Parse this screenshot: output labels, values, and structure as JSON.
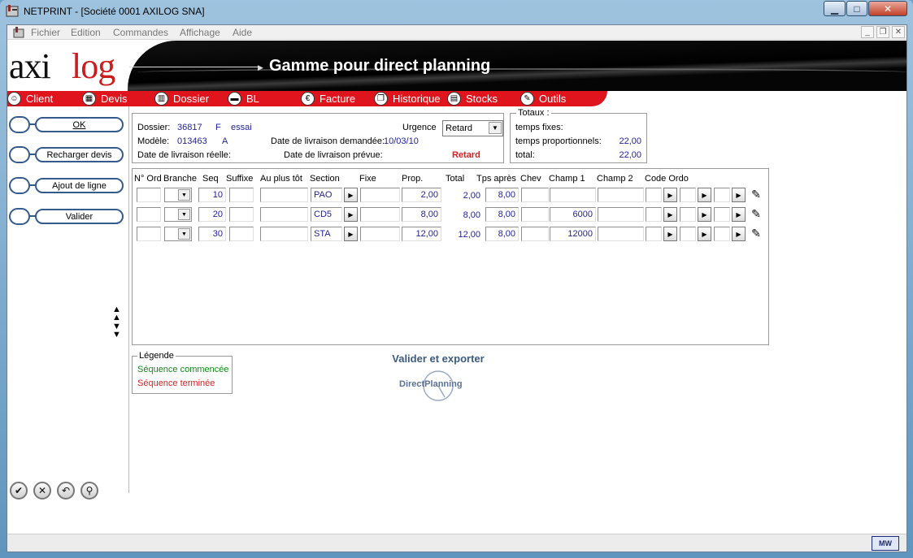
{
  "window": {
    "title": "NETPRINT - [Société 0001 AXILOG SNA]"
  },
  "menu": [
    "Fichier",
    "Edition",
    "Commandes",
    "Affichage",
    "Aide"
  ],
  "banner": {
    "logo_black": "axi",
    "logo_red": "log",
    "title": "Gamme pour direct planning"
  },
  "nav": [
    {
      "label": "Client",
      "icon": "client-icon"
    },
    {
      "label": "Devis",
      "icon": "calculator-icon"
    },
    {
      "label": "Dossier",
      "icon": "chart-icon"
    },
    {
      "label": "BL",
      "icon": "truck-icon"
    },
    {
      "label": "Facture",
      "icon": "euro-icon"
    },
    {
      "label": "Historique",
      "icon": "copy-icon"
    },
    {
      "label": "Stocks",
      "icon": "stocks-icon"
    },
    {
      "label": "Outils",
      "icon": "wrench-icon"
    }
  ],
  "left_buttons": [
    "OK",
    "Recharger devis",
    "Ajout de ligne",
    "Valider"
  ],
  "header": {
    "dossier_label": "Dossier:",
    "dossier_num": "36817",
    "dossier_code": "F",
    "dossier_name": "essai",
    "modele_label": "Modèle:",
    "modele_num": "013463",
    "modele_code": "A",
    "livraison_reelle_label": "Date de livraison réelle:",
    "livraison_demandee_label": "Date de livraison demandée:",
    "livraison_demandee_value": "10/03/10",
    "livraison_prevue_label": "Date de livraison prévue:",
    "urgence_label": "Urgence",
    "urgence_value": "Retard",
    "retard_text": "Retard"
  },
  "totaux": {
    "title": "Totaux :",
    "fixes_label": "temps fixes:",
    "fixes_value": "",
    "prop_label": "temps proportionnels:",
    "prop_value": "22,00",
    "total_label": "total:",
    "total_value": "22,00"
  },
  "table": {
    "columns": [
      "N° Ord",
      "Branche",
      "Seq",
      "Suffixe",
      "Au plus tôt",
      "Section",
      "Fixe",
      "Prop.",
      "Total",
      "Tps après",
      "Chev",
      "Champ 1",
      "Champ 2",
      "Code Ordo"
    ],
    "rows": [
      {
        "seq": "10",
        "section": "PAO",
        "prop": "2,00",
        "total": "2,00",
        "tps_apres": "8,00",
        "champ1": ""
      },
      {
        "seq": "20",
        "section": "CD5",
        "prop": "8,00",
        "total": "8,00",
        "tps_apres": "8,00",
        "champ1": "6000"
      },
      {
        "seq": "30",
        "section": "STA",
        "prop": "12,00",
        "total": "12,00",
        "tps_apres": "8,00",
        "champ1": "12000"
      }
    ]
  },
  "legend": {
    "title": "Légende",
    "started": "Séquence commencée",
    "finished": "Séquence terminée"
  },
  "export": {
    "title": "Valider et exporter",
    "logo_text": "DirectPlanning"
  },
  "status": {
    "badge": "MW"
  },
  "colors": {
    "nav_red": "#e0141c",
    "started": "#138a1b",
    "finished": "#e21b1b",
    "value_blue": "#1f1f9c"
  }
}
